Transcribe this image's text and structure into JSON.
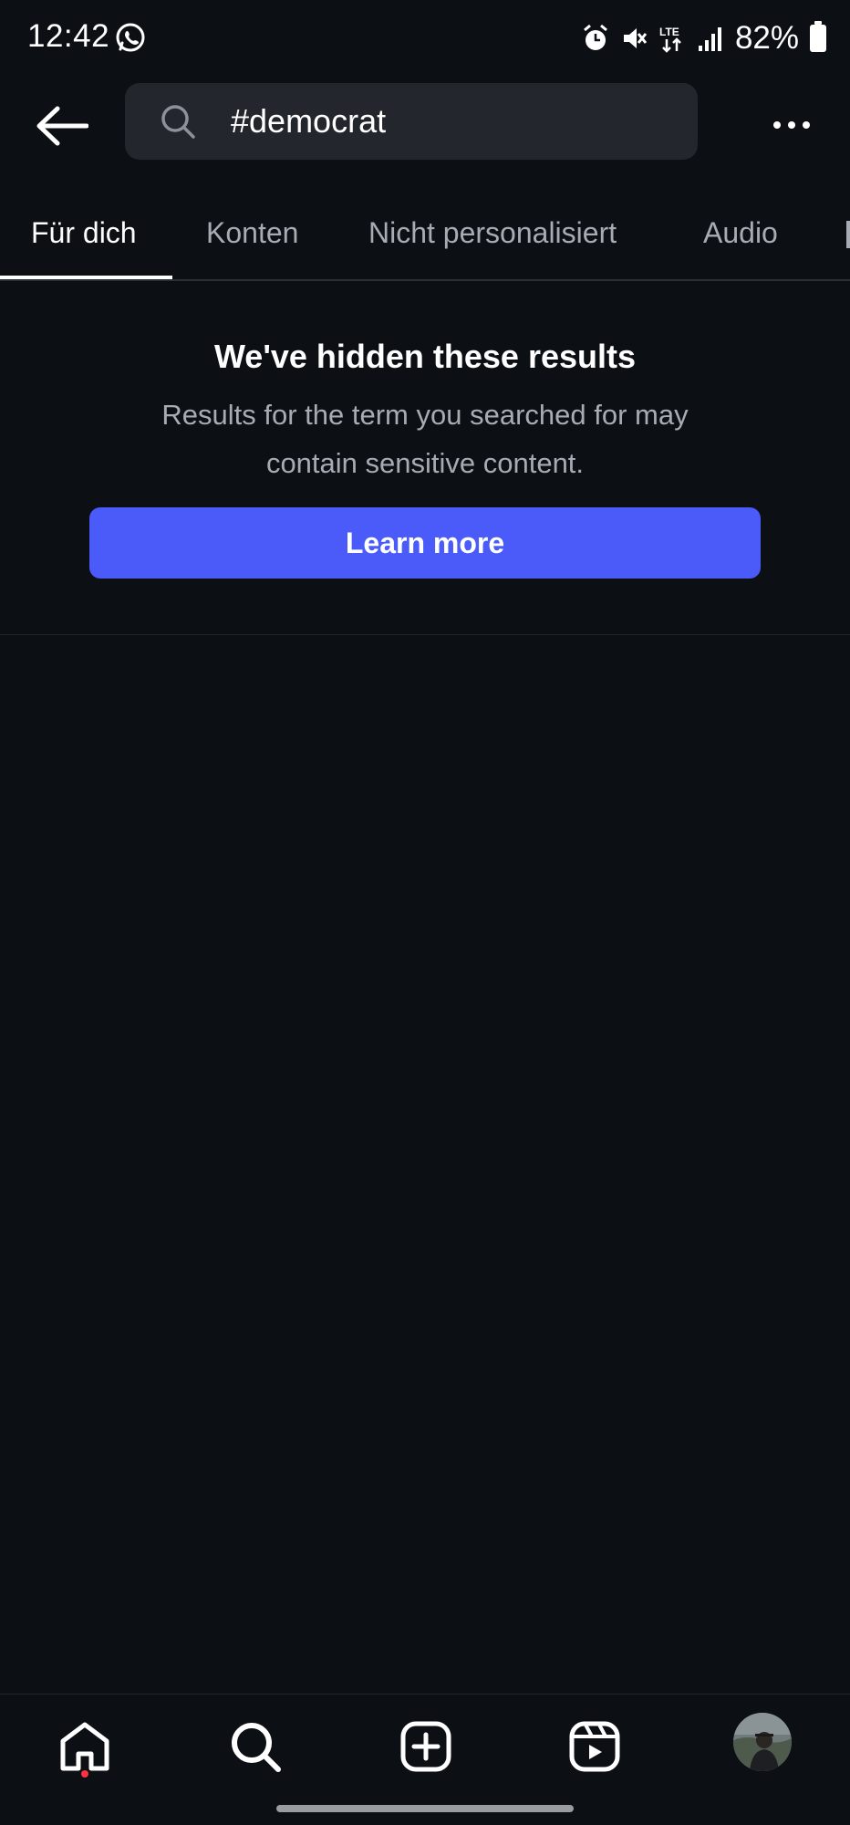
{
  "status_bar": {
    "time": "12:42",
    "battery": "82%",
    "icons": [
      "whatsapp-icon",
      "alarm-icon",
      "mute-icon",
      "lte-icon",
      "signal-icon",
      "battery-icon"
    ],
    "network_label": "LTE"
  },
  "header": {
    "search_query": "#democrat"
  },
  "tabs": [
    {
      "label": "Für dich",
      "active": true
    },
    {
      "label": "Konten",
      "active": false
    },
    {
      "label": "Nicht personalisiert",
      "active": false
    },
    {
      "label": "Audio",
      "active": false
    }
  ],
  "notice": {
    "title": "We've hidden these results",
    "body": "Results for the term you searched for may contain sensitive content.",
    "button_label": "Learn more"
  },
  "bottom_nav": {
    "items": [
      "home-icon",
      "search-icon",
      "create-icon",
      "reels-icon",
      "profile-avatar"
    ],
    "home_has_notification": true
  },
  "colors": {
    "background": "#0c0f14",
    "search_box": "#23262c",
    "primary_button": "#4a5bfa",
    "muted_text": "#a7abb4",
    "notification_dot": "#ff3040"
  }
}
